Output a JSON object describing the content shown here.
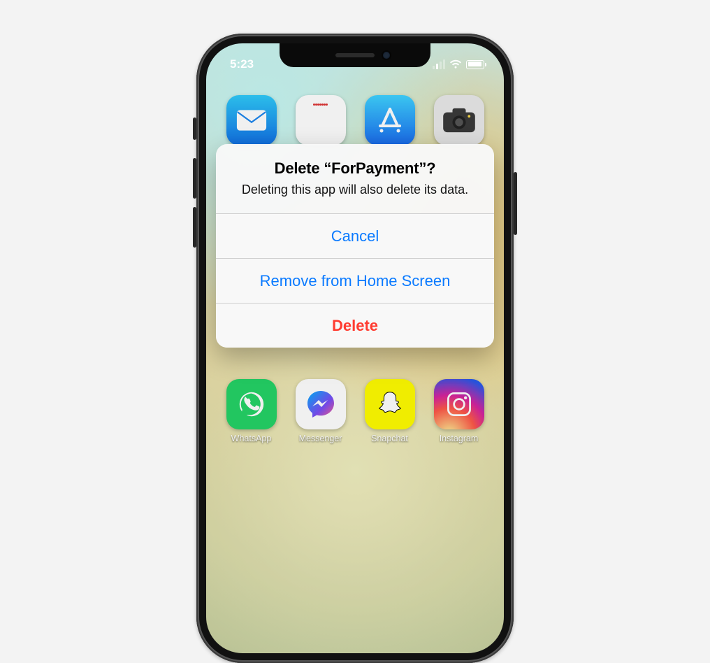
{
  "status": {
    "time": "5:23"
  },
  "alert": {
    "title": "Delete “ForPayment”?",
    "message": "Deleting this app will also delete its data.",
    "cancel": "Cancel",
    "remove": "Remove from Home Screen",
    "delete": "Delete"
  },
  "apps": {
    "row1": [
      {
        "name": "Mail"
      },
      {
        "name": "Calendar"
      },
      {
        "name": "App Store"
      },
      {
        "name": "Camera"
      }
    ],
    "row2": [
      {
        "name": "WhatsApp"
      },
      {
        "name": "Messenger"
      },
      {
        "name": "Snapchat"
      },
      {
        "name": "Instagram"
      }
    ]
  }
}
